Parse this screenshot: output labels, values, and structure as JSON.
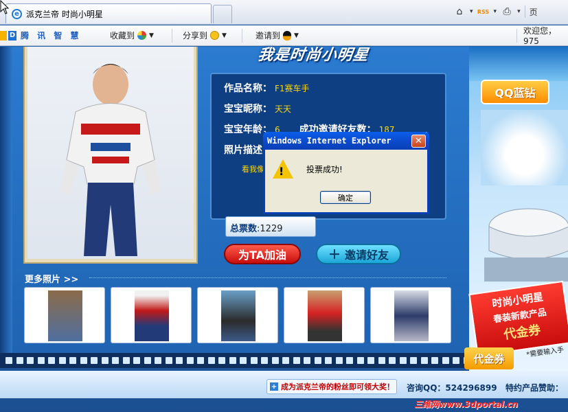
{
  "browser": {
    "tab_title": "派克兰帝 时尚小明星",
    "cmd_home": "⌂",
    "cmd_feeds": "RSS",
    "cmd_print": "⎙",
    "cmd_page": "页"
  },
  "toolbar": {
    "brand": "腾 讯 智 慧",
    "collect": "收藏到",
    "share": "分享到",
    "invite": "邀请到",
    "welcome": "欢迎您，975"
  },
  "page": {
    "banner": "我是时尚小明星",
    "work_name_label": "作品名称：",
    "work_name": "F1赛车手",
    "nickname_label": "宝宝昵称：",
    "nickname": "天天",
    "age_label": "宝宝年龄：",
    "age": "6",
    "invited_label": "成功邀请好友数：",
    "invited": "187",
    "desc_label": "照片描述",
    "desc_text": "看我像",
    "votes_label": "总票数",
    "votes_value": ":1229",
    "vote_button": "为TA加油",
    "invite_button": "邀请好友",
    "more_photos": "更多照片 >>"
  },
  "sidebar": {
    "qq_diamond": "QQ蓝钻",
    "coupon_line1": "时尚小明星",
    "coupon_line2": "春装新款产品",
    "coupon_line3": "代金券",
    "voucher": "代金券",
    "note": "*需要输入手"
  },
  "footer": {
    "fan_button": "成为派克兰帝的粉丝即可领大奖！",
    "consult": "咨询QQ：524296899",
    "sponsor": "特约产品赞助：",
    "watermark": "三维网www.3dportal.cn"
  },
  "dialog": {
    "title": "Windows Internet Explorer",
    "message": "投票成功!",
    "ok": "确定",
    "close": "✕"
  },
  "colors": {
    "accent_yellow": "#ffd800",
    "vote_red": "#c80e0e",
    "xp_blue": "#0a4fc8"
  }
}
